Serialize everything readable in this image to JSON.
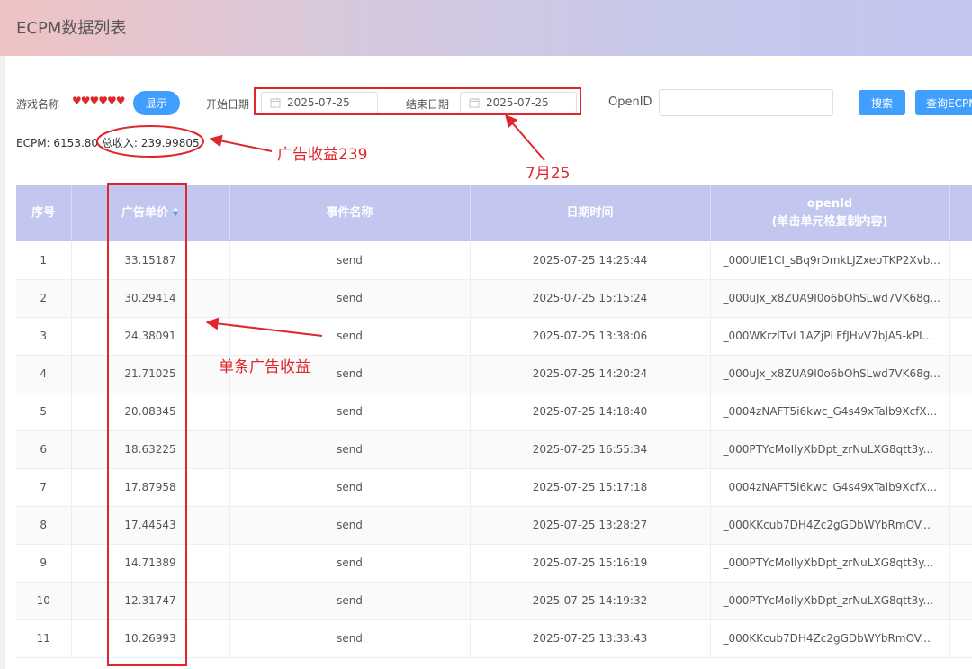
{
  "header": {
    "title": "ECPM数据列表"
  },
  "filters": {
    "game_label": "游戏名称",
    "game_value": "♥♥♥♥♥♥",
    "show_button": "显示",
    "start_label": "开始日期",
    "start_value": "2025-07-25",
    "end_label": "结束日期",
    "end_value": "2025-07-25",
    "openid_label": "OpenID",
    "openid_value": "",
    "search_button": "搜索",
    "query_button": "查询ECPM"
  },
  "stats": {
    "ecpm": "ECPM: 6153.80",
    "income": "总收入: 239.99805"
  },
  "annotations": {
    "income": "广告收益239",
    "date": "7月25",
    "single": "单条广告收益"
  },
  "table": {
    "columns": {
      "index": "序号",
      "price": "广告单价",
      "event": "事件名称",
      "datetime": "日期时间",
      "openid": "openId",
      "openid_hint": "(单击单元格复制内容)"
    },
    "rows": [
      {
        "index": "1",
        "price": "33.15187",
        "event": "send",
        "datetime": "2025-07-25 14:25:44",
        "openid": "_000UIE1CI_sBq9rDmkLJZxeoTKP2Xvb..."
      },
      {
        "index": "2",
        "price": "30.29414",
        "event": "send",
        "datetime": "2025-07-25 15:15:24",
        "openid": "_000uJx_x8ZUA9I0o6bOhSLwd7VK68g..."
      },
      {
        "index": "3",
        "price": "24.38091",
        "event": "send",
        "datetime": "2025-07-25 13:38:06",
        "openid": "_000WKrzlTvL1AZjPLFfJHvV7bJA5-kPI..."
      },
      {
        "index": "4",
        "price": "21.71025",
        "event": "send",
        "datetime": "2025-07-25 14:20:24",
        "openid": "_000uJx_x8ZUA9I0o6bOhSLwd7VK68g..."
      },
      {
        "index": "5",
        "price": "20.08345",
        "event": "send",
        "datetime": "2025-07-25 14:18:40",
        "openid": "_0004zNAFT5i6kwc_G4s49xTalb9XcfX..."
      },
      {
        "index": "6",
        "price": "18.63225",
        "event": "send",
        "datetime": "2025-07-25 16:55:34",
        "openid": "_000PTYcMoIlyXbDpt_zrNuLXG8qtt3y..."
      },
      {
        "index": "7",
        "price": "17.87958",
        "event": "send",
        "datetime": "2025-07-25 15:17:18",
        "openid": "_0004zNAFT5i6kwc_G4s49xTalb9XcfX..."
      },
      {
        "index": "8",
        "price": "17.44543",
        "event": "send",
        "datetime": "2025-07-25 13:28:27",
        "openid": "_000KKcub7DH4Zc2gGDbWYbRmOV..."
      },
      {
        "index": "9",
        "price": "14.71389",
        "event": "send",
        "datetime": "2025-07-25 15:16:19",
        "openid": "_000PTYcMoIlyXbDpt_zrNuLXG8qtt3y..."
      },
      {
        "index": "10",
        "price": "12.31747",
        "event": "send",
        "datetime": "2025-07-25 14:19:32",
        "openid": "_000PTYcMoIlyXbDpt_zrNuLXG8qtt3y..."
      },
      {
        "index": "11",
        "price": "10.26993",
        "event": "send",
        "datetime": "2025-07-25 13:33:43",
        "openid": "_000KKcub7DH4Zc2gGDbWYbRmOV..."
      }
    ]
  },
  "colors": {
    "accent": "#409eff",
    "annotation": "#e0262c",
    "table_header": "#c3c7f0"
  }
}
